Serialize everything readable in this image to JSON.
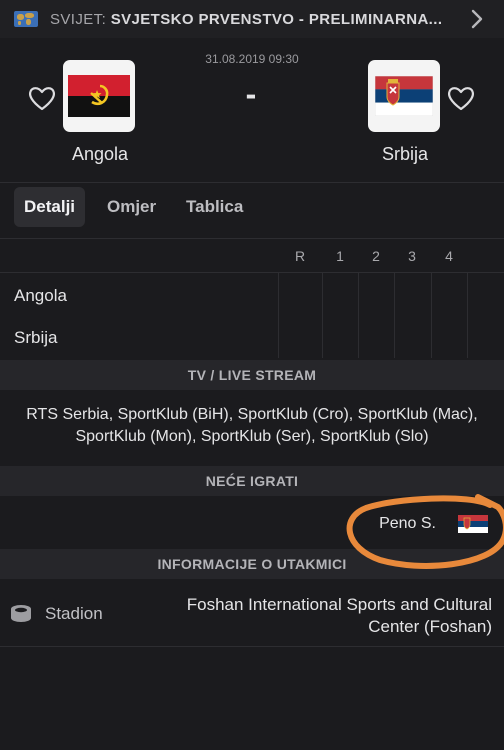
{
  "header": {
    "breadcrumb_prefix": "SVIJET: ",
    "breadcrumb_title": "SVJETSKO PRVENSTVO - PRELIMINARNA...",
    "globe_icon": "world-map-icon",
    "next_icon": "chevron-right-icon"
  },
  "match": {
    "datetime": "31.08.2019 09:30",
    "score": "-",
    "home": {
      "name": "Angola",
      "flag": "angola-flag",
      "fav_icon": "heart-outline-icon"
    },
    "away": {
      "name": "Srbija",
      "flag": "serbia-flag",
      "fav_icon": "heart-outline-icon"
    }
  },
  "tabs": [
    {
      "label": "Detalji",
      "active": true
    },
    {
      "label": "Omjer",
      "active": false
    },
    {
      "label": "Tablica",
      "active": false
    }
  ],
  "scoreboard": {
    "columns": [
      "R",
      "1",
      "2",
      "3",
      "4"
    ],
    "rows": [
      "Angola",
      "Srbija"
    ]
  },
  "tv": {
    "title": "TV / LIVE STREAM",
    "channels": "RTS Serbia, SportKlub (BiH), SportKlub (Cro), SportKlub (Mac), SportKlub (Mon), SportKlub (Ser), SportKlub (Slo)"
  },
  "absent": {
    "title": "NEĆE IGRATI",
    "player": "Peno S.",
    "flag": "serbia-flag",
    "highlight_color": "#e8893b"
  },
  "info": {
    "title": "INFORMACIJE O UTAKMICI",
    "stadium_label": "Stadion",
    "stadium_value": "Foshan International Sports and Cultural Center (Foshan)",
    "stadium_icon": "stadium-icon"
  },
  "colors": {
    "background": "#1b1b1e",
    "section_bar": "#26262a",
    "angola_red": "#d2202f",
    "angola_black": "#111111",
    "serbia_red": "#c6363c",
    "serbia_blue": "#0c4076",
    "serbia_white": "#ffffff"
  }
}
